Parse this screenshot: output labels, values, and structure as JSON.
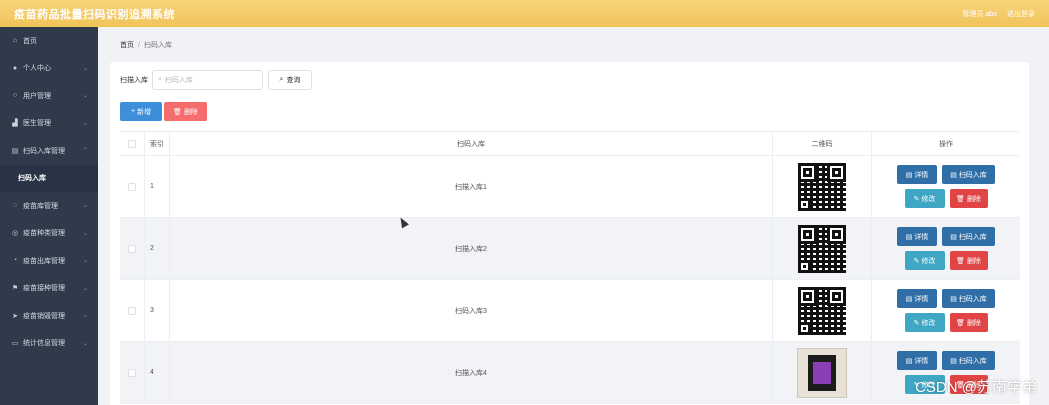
{
  "header": {
    "title": "疫苗药品批量扫码识别追溯系统",
    "user": "管理员 abo",
    "logout": "退出登录"
  },
  "sidebar": {
    "items": [
      {
        "label": "首页",
        "icon": "home-icon",
        "chevron": false
      },
      {
        "label": "个人中心",
        "icon": "user-icon",
        "chevron": true
      },
      {
        "label": "用户管理",
        "icon": "users-icon",
        "chevron": true
      },
      {
        "label": "医生管理",
        "icon": "doctor-icon",
        "chevron": true
      },
      {
        "label": "扫码入库管理",
        "icon": "scan-icon",
        "chevron": true,
        "expanded": true
      },
      {
        "label": "扫码入库",
        "sub": true
      },
      {
        "label": "疫苗库管理",
        "icon": "database-icon",
        "chevron": true
      },
      {
        "label": "疫苗种类管理",
        "icon": "category-icon",
        "chevron": true
      },
      {
        "label": "疫苗出库管理",
        "icon": "outbound-icon",
        "chevron": true
      },
      {
        "label": "疫苗接种管理",
        "icon": "flag-icon",
        "chevron": true
      },
      {
        "label": "疫苗销毁管理",
        "icon": "send-icon",
        "chevron": true
      },
      {
        "label": "统计信息管理",
        "icon": "chart-icon",
        "chevron": true
      }
    ]
  },
  "breadcrumb": {
    "home": "首页",
    "separator": "/",
    "current": "扫码入库"
  },
  "search": {
    "label": "扫描入库",
    "placeholder": "扫码入库",
    "button": "查询"
  },
  "actions": {
    "add": "新增",
    "delete": "删除"
  },
  "table": {
    "headers": {
      "index": "索引",
      "name": "扫码入库",
      "qr": "二维码",
      "ops": "操作"
    },
    "rows": [
      {
        "index": "1",
        "name": "扫描入库1",
        "image": "qr-code"
      },
      {
        "index": "2",
        "name": "扫描入库2",
        "image": "qr-code"
      },
      {
        "index": "3",
        "name": "扫码入库3",
        "image": "qr-code"
      },
      {
        "index": "4",
        "name": "扫描入库4",
        "image": "photo"
      }
    ],
    "row_buttons": {
      "detail": "详情",
      "scan": "扫码入库",
      "edit": "修改",
      "remove": "删除"
    }
  },
  "watermark": "CSDN @苏南学弟",
  "colors": {
    "topbar": "#f1c45a",
    "sidebar": "#2f3b4b",
    "primary": "#3c8fd8",
    "danger": "#f56c6c",
    "info": "#3fa6c4"
  }
}
